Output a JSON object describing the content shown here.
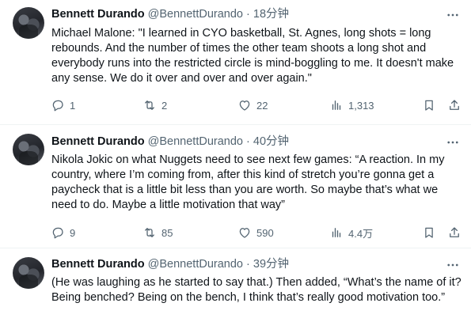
{
  "tweets": [
    {
      "name": "Bennett Durando",
      "handle": "@BennettDurando",
      "separator": "·",
      "time": "18分钟",
      "text": "Michael Malone: \"I learned in CYO basketball, St. Agnes, long shots = long rebounds. And the number of times the other team shoots a long shot and everybody runs into the restricted circle is mind-boggling to me. It doesn't make any sense. We do it over and over and over again.\"",
      "replies": "1",
      "retweets": "2",
      "likes": "22",
      "views": "1,313"
    },
    {
      "name": "Bennett Durando",
      "handle": "@BennettDurando",
      "separator": "·",
      "time": "40分钟",
      "text": "Nikola Jokic on what Nuggets need to see next few games: “A reaction. In my country, where I’m coming from, after this kind of stretch you’re gonna get a paycheck that is a little bit less than you are worth. So maybe that’s what we need to do. Maybe a little motivation that way”",
      "replies": "9",
      "retweets": "85",
      "likes": "590",
      "views": "4.4万"
    },
    {
      "name": "Bennett Durando",
      "handle": "@BennettDurando",
      "separator": "·",
      "time": "39分钟",
      "text": "(He was laughing as he started to say that.) Then added, “What’s the name of it? Being benched? Being on the bench, I think that’s really good motivation too.”"
    }
  ],
  "icons": {
    "more": "more-horizontal-icon",
    "reply": "reply-icon",
    "retweet": "retweet-icon",
    "like": "heart-icon",
    "views": "views-chart-icon",
    "bookmark": "bookmark-icon",
    "share": "share-icon"
  },
  "colors": {
    "text": "#0f1419",
    "secondary": "#536471",
    "divider": "#eff3f4"
  }
}
